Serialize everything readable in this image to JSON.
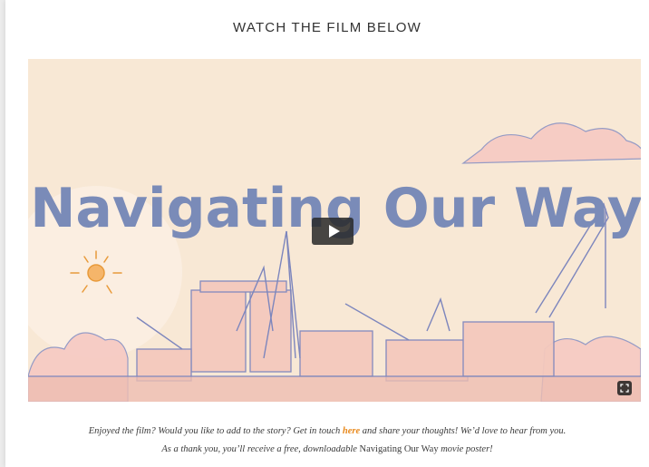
{
  "section": {
    "heading": "WATCH THE FILM BELOW"
  },
  "video": {
    "title_art": "Navigating Our Way",
    "play_icon": "play-icon",
    "fullscreen_icon": "fullscreen-icon"
  },
  "caption": {
    "line1_before": "Enjoyed the film? Would you like to add to the story? Get in touch ",
    "line1_link": "here",
    "line1_after": " and share your thoughts! We’d love to hear from you.",
    "line2_before": "As a thank you, you’ll receive a free, downloadable ",
    "line2_title": "Navigating Our Way",
    "line2_after": " movie poster!"
  },
  "colors": {
    "link": "#e8891c",
    "title_art": "#7a8bb8",
    "video_bg": "#f7e6d2"
  }
}
